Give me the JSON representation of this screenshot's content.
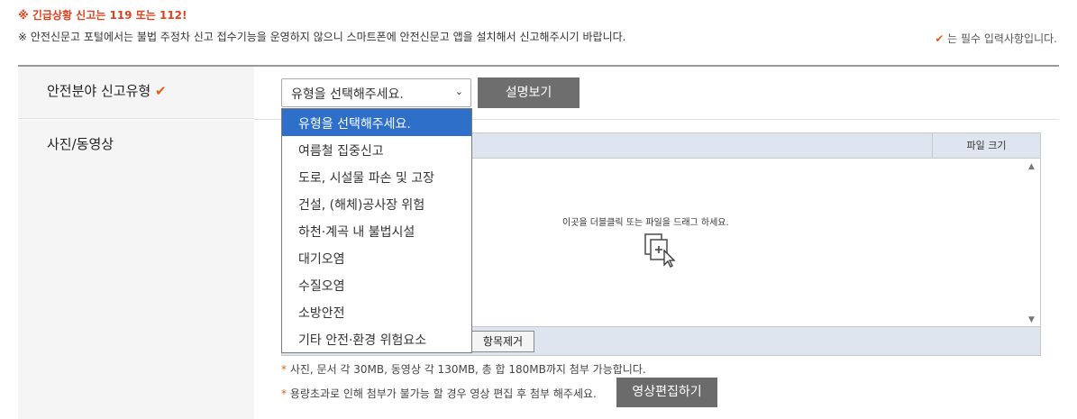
{
  "notices": {
    "emergency": "※ 긴급상황 신고는 119 또는 112!",
    "info": "※ 안전신문고 포털에서는 불법 주정차 신고 접수기능을 운영하지 않으니 스마트폰에 안전신문고 앱을 설치해서 신고해주시기 바랍니다.",
    "required_note": "는 필수 입력사항입니다."
  },
  "form": {
    "report_type_label": "안전분야 신고유형",
    "select_value": "유형을 선택해주세요.",
    "explain_button": "설명보기",
    "media_label": "사진/동영상"
  },
  "dropdown": {
    "options": [
      "유형을 선택해주세요.",
      "여름철 집중신고",
      "도로, 시설물 파손 및 고장",
      "건설, (해체)공사장 위험",
      "하천·계곡 내 불법시설",
      "대기오염",
      "수질오염",
      "소방안전",
      "기타 안전·환경 위험요소"
    ],
    "selected_index": 0
  },
  "uploader": {
    "col_file_size": "파일 크기",
    "drop_text": "이곳을 더블클릭 또는 파일을 드래그 하세요.",
    "remove_button": "항목제거"
  },
  "hints": {
    "size_limit": "사진, 문서 각 30MB, 동영상 각 130MB, 총 합 180MB까지 첨부 가능합니다.",
    "overflow": "용량초과로 인해 첨부가 불가능 할 경우 영상 편집 후 첨부 해주세요.",
    "edit_button": "영상편집하기",
    "star": "*"
  },
  "icons": {
    "required": "check-icon",
    "drop": "file-add-icon"
  },
  "colors": {
    "accent": "#e2601c",
    "emergency": "#e2401c",
    "selected_option": "#2e6fc9",
    "button": "#6e6e6e"
  }
}
